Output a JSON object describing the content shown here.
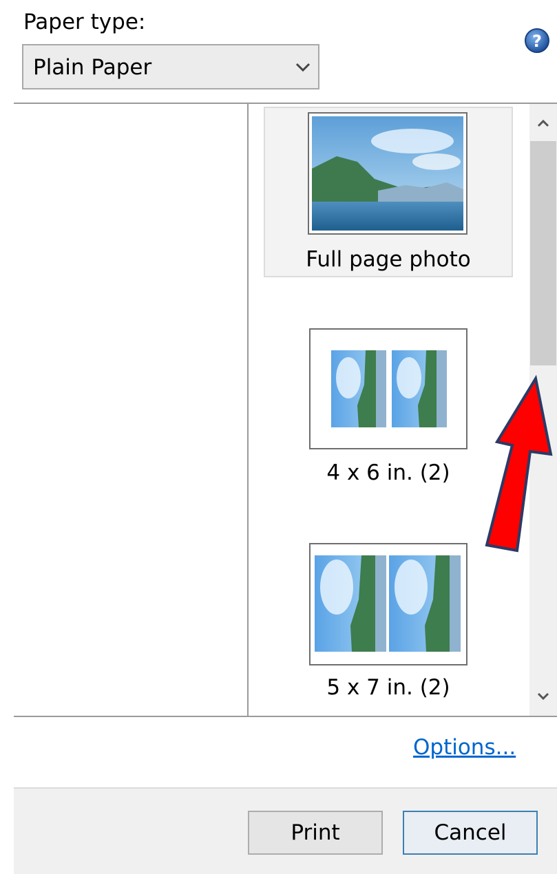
{
  "paper_type": {
    "label": "Paper type:",
    "selected": "Plain Paper"
  },
  "layouts": [
    {
      "caption": "Full page photo",
      "selected": true
    },
    {
      "caption": "4 x 6 in. (2)",
      "selected": false
    },
    {
      "caption": "5 x 7 in. (2)",
      "selected": false
    }
  ],
  "links": {
    "options": "Options..."
  },
  "buttons": {
    "print": "Print",
    "cancel": "Cancel"
  },
  "colors": {
    "arrow": "#ff0000",
    "arrow_outline": "#2b3a66",
    "link": "#0066cc",
    "help": "#2f6db5"
  },
  "icons": {
    "help": "help-icon",
    "dropdown": "chevron-down-icon",
    "scroll_up": "chevron-up-icon",
    "scroll_down": "chevron-down-icon"
  }
}
